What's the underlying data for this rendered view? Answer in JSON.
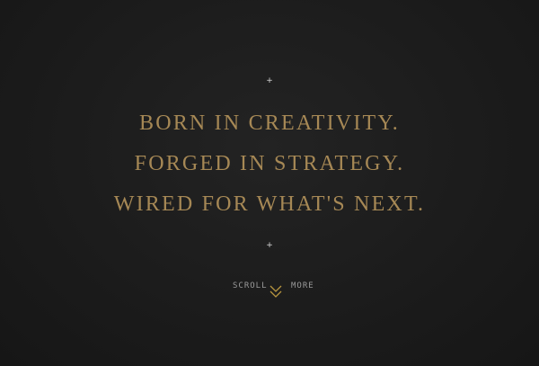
{
  "decorations": {
    "plus_top": "+",
    "plus_bottom": "+"
  },
  "tagline": {
    "line1": "BORN IN CREATIVITY.",
    "line2": "FORGED IN STRATEGY.",
    "line3": "WIRED FOR WHAT'S NEXT."
  },
  "scroll": {
    "left_label": "SCROLL",
    "right_label": "MORE",
    "icon": "chevron-down-double-icon"
  },
  "colors": {
    "background": "#1c1c1c",
    "accent_gold": "#a68855",
    "chevron_gold": "#b8963f",
    "muted_text": "#9a9a9a"
  }
}
